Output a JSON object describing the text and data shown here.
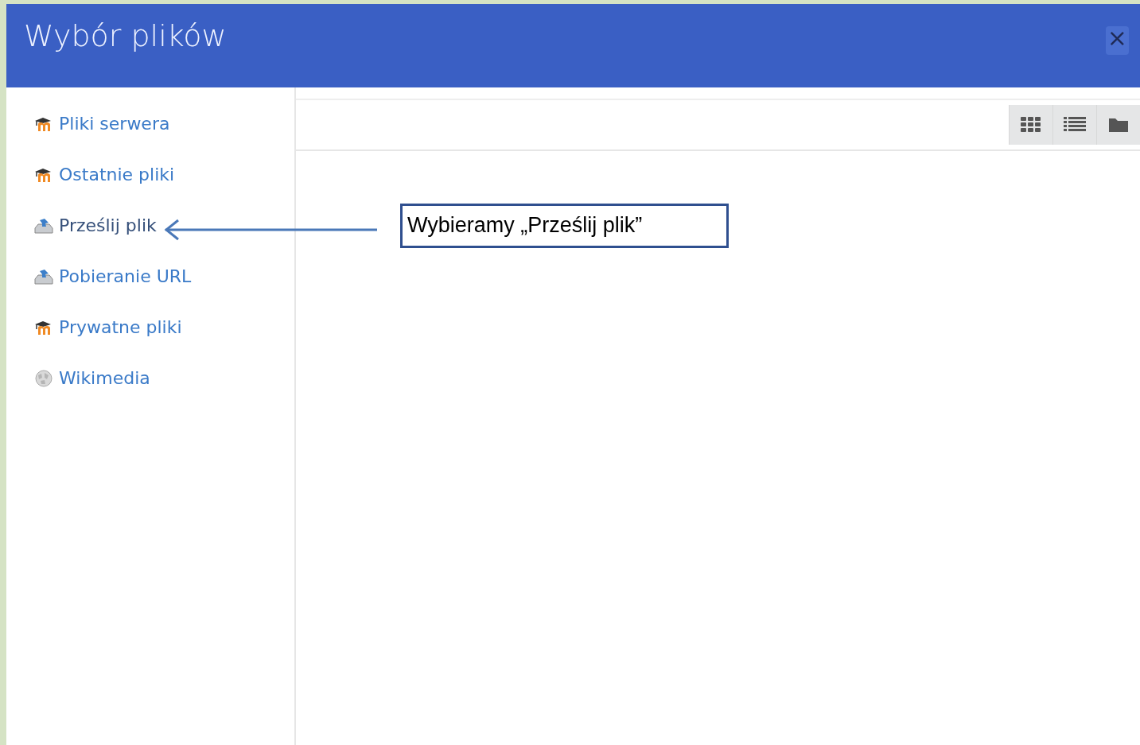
{
  "dialog": {
    "title": "Wybór plików",
    "close": "×"
  },
  "sidebar": {
    "items": [
      {
        "label": "Pliki serwera",
        "kind": "moodle",
        "selected": false
      },
      {
        "label": "Ostatnie pliki",
        "kind": "moodle",
        "selected": false
      },
      {
        "label": "Prześlij plik",
        "kind": "upload",
        "selected": true
      },
      {
        "label": "Pobieranie URL",
        "kind": "upload",
        "selected": false
      },
      {
        "label": "Prywatne pliki",
        "kind": "moodle",
        "selected": false
      },
      {
        "label": "Wikimedia",
        "kind": "globe",
        "selected": false
      }
    ]
  },
  "toolbar": {
    "view_buttons": [
      {
        "kind": "icons"
      },
      {
        "kind": "list"
      },
      {
        "kind": "tree"
      }
    ]
  },
  "annotation": {
    "text": "Wybieramy „Prześlij plik”"
  }
}
